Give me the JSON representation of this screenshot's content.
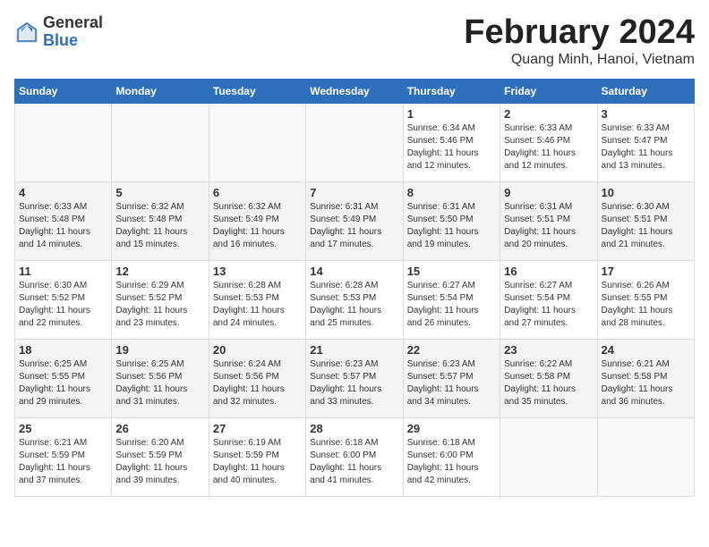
{
  "header": {
    "logo_general": "General",
    "logo_blue": "Blue",
    "month_title": "February 2024",
    "subtitle": "Quang Minh, Hanoi, Vietnam"
  },
  "days_of_week": [
    "Sunday",
    "Monday",
    "Tuesday",
    "Wednesday",
    "Thursday",
    "Friday",
    "Saturday"
  ],
  "weeks": [
    [
      {
        "day": "",
        "info": ""
      },
      {
        "day": "",
        "info": ""
      },
      {
        "day": "",
        "info": ""
      },
      {
        "day": "",
        "info": ""
      },
      {
        "day": "1",
        "info": "Sunrise: 6:34 AM\nSunset: 5:46 PM\nDaylight: 11 hours\nand 12 minutes."
      },
      {
        "day": "2",
        "info": "Sunrise: 6:33 AM\nSunset: 5:46 PM\nDaylight: 11 hours\nand 12 minutes."
      },
      {
        "day": "3",
        "info": "Sunrise: 6:33 AM\nSunset: 5:47 PM\nDaylight: 11 hours\nand 13 minutes."
      }
    ],
    [
      {
        "day": "4",
        "info": "Sunrise: 6:33 AM\nSunset: 5:48 PM\nDaylight: 11 hours\nand 14 minutes."
      },
      {
        "day": "5",
        "info": "Sunrise: 6:32 AM\nSunset: 5:48 PM\nDaylight: 11 hours\nand 15 minutes."
      },
      {
        "day": "6",
        "info": "Sunrise: 6:32 AM\nSunset: 5:49 PM\nDaylight: 11 hours\nand 16 minutes."
      },
      {
        "day": "7",
        "info": "Sunrise: 6:31 AM\nSunset: 5:49 PM\nDaylight: 11 hours\nand 17 minutes."
      },
      {
        "day": "8",
        "info": "Sunrise: 6:31 AM\nSunset: 5:50 PM\nDaylight: 11 hours\nand 19 minutes."
      },
      {
        "day": "9",
        "info": "Sunrise: 6:31 AM\nSunset: 5:51 PM\nDaylight: 11 hours\nand 20 minutes."
      },
      {
        "day": "10",
        "info": "Sunrise: 6:30 AM\nSunset: 5:51 PM\nDaylight: 11 hours\nand 21 minutes."
      }
    ],
    [
      {
        "day": "11",
        "info": "Sunrise: 6:30 AM\nSunset: 5:52 PM\nDaylight: 11 hours\nand 22 minutes."
      },
      {
        "day": "12",
        "info": "Sunrise: 6:29 AM\nSunset: 5:52 PM\nDaylight: 11 hours\nand 23 minutes."
      },
      {
        "day": "13",
        "info": "Sunrise: 6:28 AM\nSunset: 5:53 PM\nDaylight: 11 hours\nand 24 minutes."
      },
      {
        "day": "14",
        "info": "Sunrise: 6:28 AM\nSunset: 5:53 PM\nDaylight: 11 hours\nand 25 minutes."
      },
      {
        "day": "15",
        "info": "Sunrise: 6:27 AM\nSunset: 5:54 PM\nDaylight: 11 hours\nand 26 minutes."
      },
      {
        "day": "16",
        "info": "Sunrise: 6:27 AM\nSunset: 5:54 PM\nDaylight: 11 hours\nand 27 minutes."
      },
      {
        "day": "17",
        "info": "Sunrise: 6:26 AM\nSunset: 5:55 PM\nDaylight: 11 hours\nand 28 minutes."
      }
    ],
    [
      {
        "day": "18",
        "info": "Sunrise: 6:25 AM\nSunset: 5:55 PM\nDaylight: 11 hours\nand 29 minutes."
      },
      {
        "day": "19",
        "info": "Sunrise: 6:25 AM\nSunset: 5:56 PM\nDaylight: 11 hours\nand 31 minutes."
      },
      {
        "day": "20",
        "info": "Sunrise: 6:24 AM\nSunset: 5:56 PM\nDaylight: 11 hours\nand 32 minutes."
      },
      {
        "day": "21",
        "info": "Sunrise: 6:23 AM\nSunset: 5:57 PM\nDaylight: 11 hours\nand 33 minutes."
      },
      {
        "day": "22",
        "info": "Sunrise: 6:23 AM\nSunset: 5:57 PM\nDaylight: 11 hours\nand 34 minutes."
      },
      {
        "day": "23",
        "info": "Sunrise: 6:22 AM\nSunset: 5:58 PM\nDaylight: 11 hours\nand 35 minutes."
      },
      {
        "day": "24",
        "info": "Sunrise: 6:21 AM\nSunset: 5:58 PM\nDaylight: 11 hours\nand 36 minutes."
      }
    ],
    [
      {
        "day": "25",
        "info": "Sunrise: 6:21 AM\nSunset: 5:59 PM\nDaylight: 11 hours\nand 37 minutes."
      },
      {
        "day": "26",
        "info": "Sunrise: 6:20 AM\nSunset: 5:59 PM\nDaylight: 11 hours\nand 39 minutes."
      },
      {
        "day": "27",
        "info": "Sunrise: 6:19 AM\nSunset: 5:59 PM\nDaylight: 11 hours\nand 40 minutes."
      },
      {
        "day": "28",
        "info": "Sunrise: 6:18 AM\nSunset: 6:00 PM\nDaylight: 11 hours\nand 41 minutes."
      },
      {
        "day": "29",
        "info": "Sunrise: 6:18 AM\nSunset: 6:00 PM\nDaylight: 11 hours\nand 42 minutes."
      },
      {
        "day": "",
        "info": ""
      },
      {
        "day": "",
        "info": ""
      }
    ]
  ]
}
